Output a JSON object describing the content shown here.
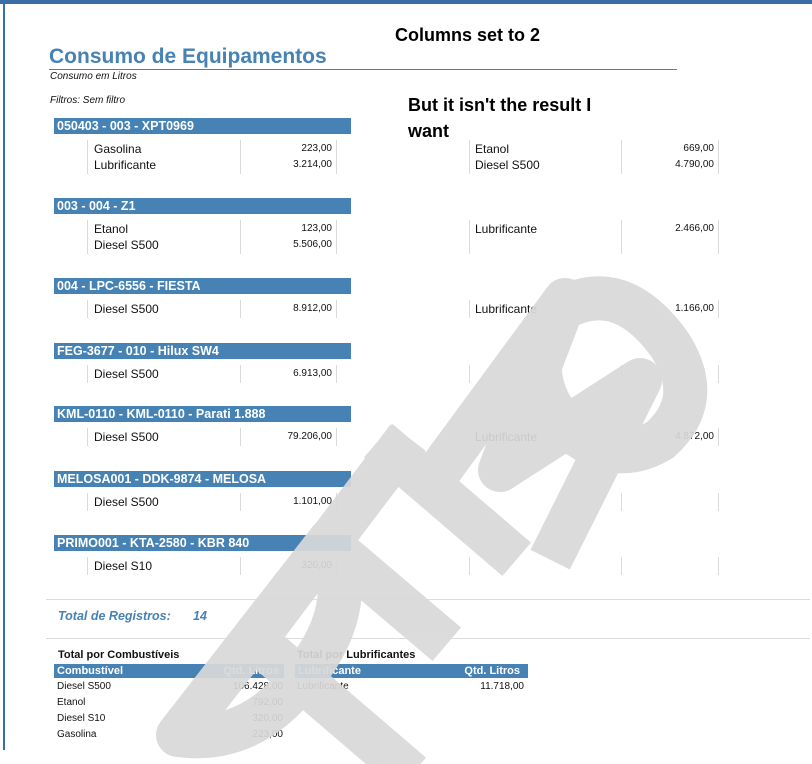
{
  "annotations": {
    "columns": "Columns set to 2",
    "result_line1": "But it isn't the result I",
    "result_line2": "want"
  },
  "report": {
    "title": "Consumo de Equipamentos",
    "subtitle": "Consumo em Litros",
    "filters": "Filtros: Sem filtro"
  },
  "groups": [
    {
      "header": "050403 - 003 - XPT0969",
      "left": [
        {
          "item": "Gasolina",
          "qty": "223,00"
        },
        {
          "item": "Lubrificante",
          "qty": "3.214,00"
        }
      ],
      "right": [
        {
          "item": "Etanol",
          "qty": "669,00"
        },
        {
          "item": "Diesel S500",
          "qty": "4.790,00"
        }
      ]
    },
    {
      "header": "003 - 004 - Z1",
      "left": [
        {
          "item": "Etanol",
          "qty": "123,00"
        },
        {
          "item": "Diesel S500",
          "qty": "5.506,00"
        }
      ],
      "right": [
        {
          "item": "Lubrificante",
          "qty": "2.466,00"
        }
      ]
    },
    {
      "header": "004 - LPC-6556 - FIESTA",
      "left": [
        {
          "item": "Diesel S500",
          "qty": "8.912,00"
        }
      ],
      "right": [
        {
          "item": "Lubrificante",
          "qty": "1.166,00"
        }
      ]
    },
    {
      "header": "FEG-3677 - 010 - Hilux SW4",
      "left": [
        {
          "item": "Diesel S500",
          "qty": "6.913,00"
        }
      ],
      "right": []
    },
    {
      "header": "KML-0110 - KML-0110 - Parati 1.888",
      "left": [
        {
          "item": "Diesel S500",
          "qty": "79.206,00"
        }
      ],
      "right": [
        {
          "item": "Lubrificante",
          "qty": "4.872,00"
        }
      ]
    },
    {
      "header": "MELOSA001 - DDK-9874 - MELOSA",
      "left": [
        {
          "item": "Diesel S500",
          "qty": "1.101,00"
        }
      ],
      "right": []
    },
    {
      "header": "PRIMO001 - KTA-2580 - KBR 840",
      "left": [
        {
          "item": "Diesel S10",
          "qty": "320,00"
        }
      ],
      "right": []
    }
  ],
  "totals": {
    "label": "Total de Registros:",
    "count": "14"
  },
  "fuel_summary": {
    "title": "Total por Combustíveis",
    "col1": "Combustível",
    "col2": "Qtd. Litros",
    "rows": [
      {
        "name": "Diesel S500",
        "qty": "106.428,00"
      },
      {
        "name": "Etanol",
        "qty": "792,00"
      },
      {
        "name": "Diesel S10",
        "qty": "320,00"
      },
      {
        "name": "Gasolina",
        "qty": "223,00"
      }
    ]
  },
  "lube_summary": {
    "title": "Total por Lubrificantes",
    "col1": "Lubrificante",
    "col2": "Qtd. Litros",
    "rows": [
      {
        "name": "Lubrificante",
        "qty": "11.718,00"
      }
    ]
  },
  "watermark": "DEMO",
  "colors": {
    "accent": "#4682b4",
    "frame": "#3a6ea5",
    "watermark": "#d9d9d9"
  }
}
